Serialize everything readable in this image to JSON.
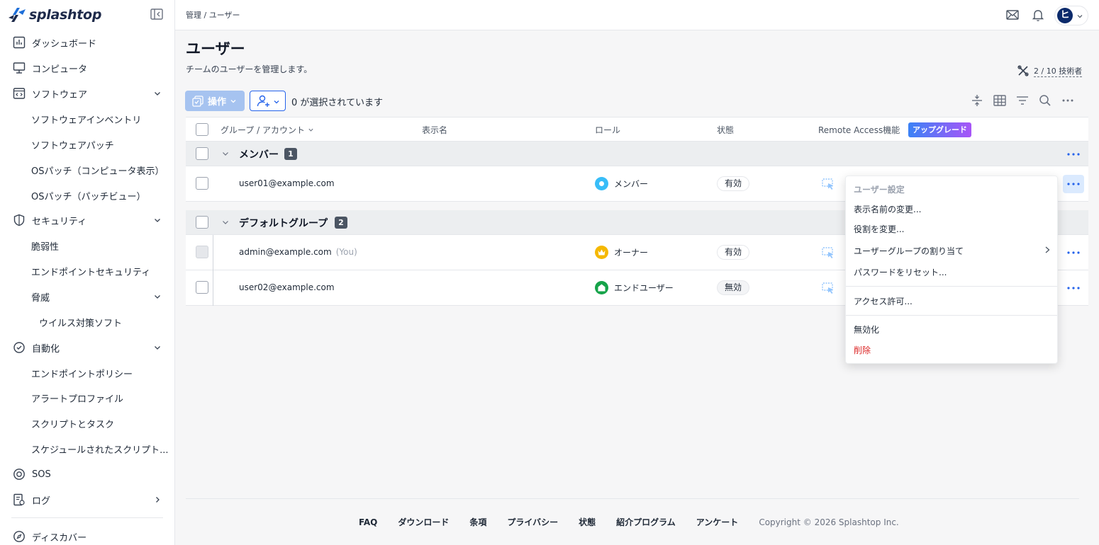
{
  "app": {
    "brand": "splashtop"
  },
  "sidebar": {
    "items": [
      {
        "label": "ダッシュボード",
        "icon": "dashboard-icon"
      },
      {
        "label": "コンピュータ",
        "icon": "monitor-icon"
      },
      {
        "label": "ソフトウェア",
        "icon": "software-icon"
      },
      {
        "label": "ソフトウェアインベントリ"
      },
      {
        "label": "ソフトウェアパッチ"
      },
      {
        "label": "OSパッチ（コンピュータ表示）"
      },
      {
        "label": "OSパッチ（パッチビュー）"
      },
      {
        "label": "セキュリティ",
        "icon": "shield-icon"
      },
      {
        "label": "脆弱性"
      },
      {
        "label": "エンドポイントセキュリティ"
      },
      {
        "label": "脅威"
      },
      {
        "label": "ウイルス対策ソフト"
      },
      {
        "label": "自動化",
        "icon": "automation-icon"
      },
      {
        "label": "エンドポイントポリシー"
      },
      {
        "label": "アラートプロファイル"
      },
      {
        "label": "スクリプトとタスク"
      },
      {
        "label": "スケジュールされたスクリプト..."
      },
      {
        "label": "SOS",
        "icon": "sos-icon"
      },
      {
        "label": "ログ",
        "icon": "log-icon"
      },
      {
        "label": "ディスカバー",
        "icon": "compass-icon"
      }
    ]
  },
  "header": {
    "breadcrumb": "管理 / ユーザー",
    "avatar_initial": "ヒ"
  },
  "main": {
    "title": "ユーザー",
    "description": "チームのユーザーを管理します。",
    "tech_count": "2 / 10 技術者",
    "action_label": "操作",
    "selected_text": "0 が選択されています"
  },
  "table": {
    "columns": {
      "group": "グループ / アカウント",
      "display_name": "表示名",
      "role": "ロール",
      "status": "状態",
      "remote": "Remote Access機能",
      "upgrade": "アップグレード"
    },
    "groups": [
      {
        "name": "メンバー",
        "count": "1",
        "rows": [
          {
            "email": "user01@example.com",
            "you": "",
            "role": "メンバー",
            "status": "有効"
          }
        ]
      },
      {
        "name": "デフォルトグループ",
        "count": "2",
        "rows": [
          {
            "email": "admin@example.com",
            "you": "(You)",
            "role": "オーナー",
            "status": "有効"
          },
          {
            "email": "user02@example.com",
            "you": "",
            "role": "エンドユーザー",
            "status": "無効"
          }
        ]
      }
    ]
  },
  "menu": {
    "header": "ユーザー設定",
    "items": [
      "表示名前の変更...",
      "役割を変更...",
      "ユーザーグループの割り当て",
      "パスワードをリセット...",
      "アクセス許可...",
      "無効化",
      "削除"
    ]
  },
  "footer": {
    "links": [
      "FAQ",
      "ダウンロード",
      "条項",
      "プライバシー",
      "状態",
      "紹介プログラム",
      "アンケート"
    ],
    "copyright": "Copyright © 2026 Splashtop Inc."
  },
  "colors": {
    "accent": "#2563eb",
    "danger": "#dc2626",
    "member": "#38bdf8",
    "owner": "#f5b800",
    "enduser": "#16a34a"
  }
}
